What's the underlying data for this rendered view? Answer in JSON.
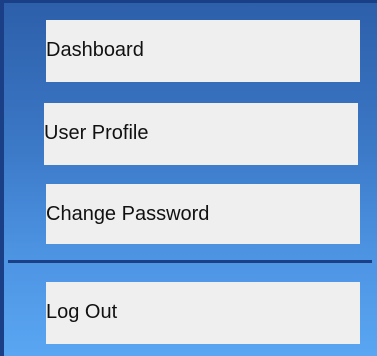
{
  "menu": {
    "items": [
      {
        "label": "Dashboard"
      },
      {
        "label": "User Profile"
      },
      {
        "label": "Change Password"
      }
    ],
    "logout": {
      "label": "Log Out"
    }
  },
  "colors": {
    "sidebar_gradient_top": "#2d5faa",
    "sidebar_gradient_bottom": "#5aa6f3",
    "border": "#1b3f86",
    "item_background": "#efefef",
    "item_text": "#111111"
  }
}
